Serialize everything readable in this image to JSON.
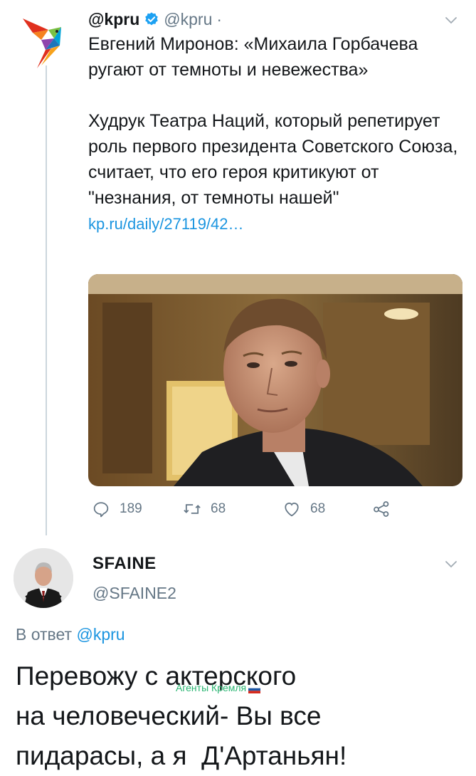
{
  "tweet1": {
    "display_name": "@kpru",
    "handle": "@kpru",
    "dot": "·",
    "icons": {
      "logo": "kp-parrot-logo",
      "verified": "verified-badge-icon",
      "menu": "chevron-down-icon"
    },
    "text_para1": "Евгений Миронов: «Михаила Горбачева ругают от темноты и невежества»",
    "text_para2": "Худрук Театра Наций, который репетирует роль первого президента Советского Союза, считает, что его героя критикуют от \"незнания, от темноты нашей\"",
    "link_text": "kp.ru/daily/27119/42…",
    "image": "photo-of-man-in-dark-jacket",
    "actions": {
      "reply_count": "189",
      "retweet_count": "68",
      "like_count": "68"
    }
  },
  "tweet2": {
    "display_name": "SFAINE",
    "handle": "@SFAINE2",
    "reply_prefix": "В ответ",
    "reply_to": "@kpru",
    "text_line1": "Перевожу с актерского",
    "text_line2": "на человеческий- Вы все",
    "text_line3": "пидарасы, а я  Д'Артаньян!",
    "watermark": "Агенты Кремля"
  },
  "colors": {
    "link": "#1b95e0",
    "secondary_text": "#657786",
    "primary_text": "#14171a",
    "thread_line": "#ccd6dd",
    "watermark": "#2bb673"
  }
}
